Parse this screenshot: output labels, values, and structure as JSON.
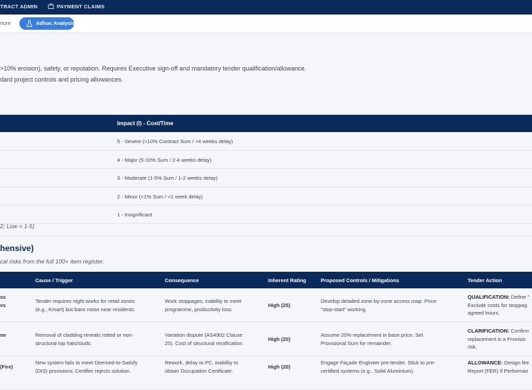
{
  "top_nav": {
    "items": [
      {
        "label": "ITRACT ADMIN"
      },
      {
        "label": "PAYMENT CLAIMS",
        "icon": "building-icon"
      }
    ]
  },
  "tabs": {
    "partial_label": "rture",
    "active": {
      "label": "Adhoc Analysis",
      "icon": "flask-icon"
    }
  },
  "intro": {
    "line1": ">10% erosion), safety, or reputation. Requires Executive sign-off and mandatory tender qualification/allowance.",
    "line2": "dard project controls and pricing allowances."
  },
  "impact_matrix": {
    "header": "Impact (I) - Cost/Time",
    "rows": [
      "5 - Severe (>10% Contract Sum / >4 weeks delay)",
      "4 - Major (5-10% Sum / 2-4 weeks delay)",
      "3 - Moderate (1-5% Sum / 1-2 weeks delay)",
      "2 - Minor (<1% Sum / <1 week delay)",
      "1 - Insignificant"
    ],
    "note": "2; Low = 1-5)"
  },
  "register": {
    "title": "hensive)",
    "subtitle": "cal risks from the full 100+ item register.",
    "columns": [
      "Cause / Trigger",
      "Consequence",
      "Inherent Rating",
      "Proposed Controls / Mitigations",
      "Tender Action"
    ],
    "rows": [
      {
        "risk_line1": "ss",
        "risk_line2": "vs",
        "cause_line1": "Tender requires night works for retail zones",
        "cause_line2": "(e.g., Kmart) but bans noise near residents.",
        "consequence_line1": "Work stoppages, inability to meet",
        "consequence_line2": "programme, productivity loss.",
        "rating": "High (25)",
        "controls_line1": "Develop detailed zone-by-zone access map. Price",
        "controls_line2": "\"stop-start\" working.",
        "action_label": "QUALIFICATION:",
        "action_line1": " Define \"",
        "action_line2": "Exclude costs for stoppag",
        "action_line3": "agreed hours."
      },
      {
        "risk_line1": "ne",
        "risk_line2": "",
        "cause_line1": "Removal of cladding reveals rotted or non-",
        "cause_line2": "structural top hats/studs.",
        "consequence_line1": "Variation dispute (AS4902 Clause",
        "consequence_line2": "25). Cost of structural rectification.",
        "rating": "High (20)",
        "controls_line1": "Assume 20% replacement in base price. Set",
        "controls_line2": "Provisional Sum for remainder.",
        "action_label": "CLARIFICATION:",
        "action_line1": " Confirm",
        "action_line2": "replacement is a Provisio",
        "action_line3": "risk."
      },
      {
        "risk_line1": "(Fire)",
        "risk_line2": "",
        "cause_line1": "New system fails to meet Deemed-to-Satisfy",
        "cause_line2": "(DtS) provisions; Certifier rejects solution.",
        "consequence_line1": "Rework, delay to PC, inability to",
        "consequence_line2": "obtain Occupation Certificate.",
        "rating": "High (20)",
        "controls_line1": "Engage Façade Engineer pre-tender. Stick to pre-",
        "controls_line2": "certified systems (e.g., Solid Aluminium).",
        "action_label": "ALLOWANCE:",
        "action_line1": " Design fee",
        "action_line2": "Report (FER) if Performan",
        "action_line3": ""
      }
    ]
  }
}
